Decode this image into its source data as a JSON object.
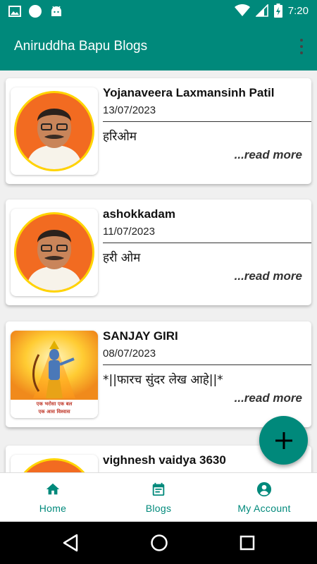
{
  "status_bar": {
    "time": "7:20",
    "icons_left": [
      "image-icon",
      "circle-icon",
      "android-icon"
    ],
    "icons_right": [
      "wifi-icon",
      "signal-icon",
      "battery-charging-icon"
    ]
  },
  "app_bar": {
    "title": "Aniruddha Bapu Blogs",
    "menu_icon": "more-vert-icon"
  },
  "posts": [
    {
      "author": "Yojanaveera Laxmansinh Patil",
      "date": "13/07/2023",
      "excerpt": "हरिओम",
      "read_more": "...read more",
      "thumbnail": "portrait"
    },
    {
      "author": "ashokkadam",
      "date": "11/07/2023",
      "excerpt": "हरी ओम",
      "read_more": "...read more",
      "thumbnail": "portrait"
    },
    {
      "author": "SANJAY GIRI",
      "date": "08/07/2023",
      "excerpt": "*||फारच सुंदर लेख आहे||*",
      "read_more": "...read more",
      "thumbnail": "deity",
      "thumb_caption_1": "एक भरोसा एक बल",
      "thumb_caption_2": "एक आस विश्वास"
    },
    {
      "author": "vighnesh vaidya 3630",
      "date": "",
      "excerpt": "",
      "read_more": "",
      "thumbnail": "portrait"
    }
  ],
  "fab": {
    "icon": "plus-icon"
  },
  "bottom_nav": [
    {
      "label": "Home",
      "icon": "home-icon"
    },
    {
      "label": "Blogs",
      "icon": "calendar-icon"
    },
    {
      "label": "My Account",
      "icon": "account-circle-icon"
    }
  ],
  "colors": {
    "primary": "#00897b",
    "portrait_bg": "#f26b21",
    "portrait_ring": "#ffd400"
  }
}
